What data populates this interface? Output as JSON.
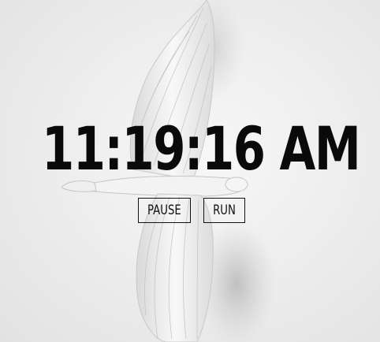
{
  "clock": {
    "time": "11:19:16 AM"
  },
  "controls": {
    "pause_label": "PAUSE",
    "run_label": "RUN"
  },
  "background": {
    "image": "white-dove-sculpture",
    "base_color": "#ededed"
  },
  "colors": {
    "text": "#0a0a0a",
    "button_border": "#111111"
  }
}
